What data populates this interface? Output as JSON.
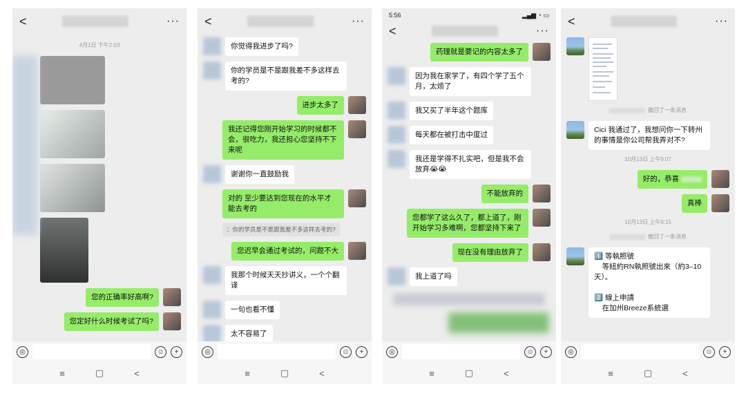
{
  "phones": [
    {
      "time": "4月1日 下午2:03",
      "messages": [
        {
          "side": "right",
          "text": "您的正确率好高啊?"
        },
        {
          "side": "right",
          "text": "您定好什么时候考试了吗?"
        }
      ]
    },
    {
      "messages": [
        {
          "side": "left",
          "text": "你觉得我进步了吗?"
        },
        {
          "side": "left",
          "text": "你的学员是不是跟我差不多这样去考的?"
        },
        {
          "side": "right",
          "text": "进步太多了"
        },
        {
          "side": "right",
          "text": "我还记得您刚开始学习的时候都不会，很吃力，我还担心您坚持不下来呢"
        },
        {
          "side": "left",
          "text": "谢谢你一直鼓励我"
        },
        {
          "side": "right",
          "text": "对的  至少要达到您现在的水平才能去考的"
        },
        {
          "side": "right",
          "text": "您迟早会通过考试的，问题不大"
        },
        {
          "side": "left",
          "text": "我那个时候天天抄讲义，一个个翻译"
        },
        {
          "side": "left",
          "text": "一句也看不懂"
        },
        {
          "side": "left",
          "text": "太不容易了"
        }
      ],
      "quote": "：你的学员是不是跟我差不多这样去考的?"
    },
    {
      "status_time": "5:56",
      "messages": [
        {
          "side": "right",
          "text": "药理就是要记的内容太多了"
        },
        {
          "side": "left",
          "text": "因为我在家学了，有四个学了五个月，太烦了"
        },
        {
          "side": "left",
          "text": "我又买了半年这个题库"
        },
        {
          "side": "left",
          "text": "每天都在被打击中度过"
        },
        {
          "side": "left",
          "text": "我还是学得不扎实吧，但是我不会放弃😭😭"
        },
        {
          "side": "right",
          "text": "不能放弃的"
        },
        {
          "side": "right",
          "text": "您都学了这么久了，都上道了，刚开始学习多难啊，您都坚持下来了"
        },
        {
          "side": "right",
          "text": "现在没有理由放弃了"
        },
        {
          "side": "left",
          "text": "我上道了吗"
        }
      ]
    },
    {
      "recall_text": "撤回了一条消息",
      "messages": [
        {
          "side": "left",
          "text": "Cici 我通过了，我想问你一下转州的事情是你公司帮我弄对不?"
        },
        {
          "side": "right",
          "text": "好的，恭喜"
        },
        {
          "side": "right",
          "text": "真棒"
        },
        {
          "side": "left",
          "text": "1️⃣ 等執照號\n    等紐約RN執照號出來（約3–10天）。\n\n2️⃣ 線上申請\n    在加州Breeze系統選"
        }
      ],
      "time1": "10月13日 上午9:07",
      "time2": "10月13日 上午9:15"
    }
  ],
  "ui": {
    "back_icon": "<",
    "more_icon": "···",
    "voice_icon": "◎",
    "emoji_icon": "☺",
    "plus_icon": "+",
    "nav_menu": "≡",
    "nav_home": "▢",
    "nav_back": "<"
  }
}
